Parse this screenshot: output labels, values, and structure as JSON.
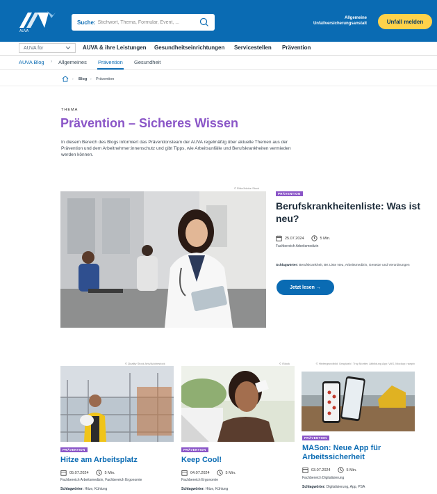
{
  "header": {
    "logo_text": "AUVA",
    "search_label": "Suche:",
    "search_placeholder": "Stichwort, Thema, Formular, Event, ...",
    "org_line1": "Allgemeine",
    "org_line2": "Unfallversicherungsanstalt",
    "unfall_button": "Unfall melden"
  },
  "nav": {
    "select_label": "AUVA für",
    "items": [
      "AUVA & ihre Leistungen",
      "Gesundheitseinrichtungen",
      "Servicestellen",
      "Prävention"
    ]
  },
  "subnav": {
    "items": [
      "AUVA Blog",
      "Allgemeines",
      "Prävention",
      "Gesundheit"
    ],
    "active": "Prävention"
  },
  "breadcrumb": {
    "items": [
      "Blog",
      "Prävention"
    ]
  },
  "intro": {
    "eyebrow": "THEMA",
    "title": "Prävention – Sicheres Wissen",
    "text": "In diesem Bereich des Blogs informiert das Präventionsteam der AUVA regelmäßig über aktuelle Themen aus der Prävention und dem Arbeitnehmer:innenschutz und gibt Tipps, wie Arbeitsunfälle und Berufskrankheiten vermieden werden können."
  },
  "featured": {
    "credit": "© Rido/Adobe Stock",
    "tag": "PRÄVENTION",
    "title": "Berufskrankheitenliste: Was ist neu?",
    "date": "25.07.2024",
    "duration": "5 Min.",
    "department": "Fachbereich Arbeitsmedizin",
    "keywords_label": "Schlagwörter:",
    "keywords": "Berufskrankheit, BK Liste Neu, Arbeitsmedizin, Gesetze und Verordnungen",
    "button": "Jetzt lesen  →"
  },
  "cards": [
    {
      "credit": "© Quality Stock Arts/Adobestock",
      "tag": "PRÄVENTION",
      "title": "Hitze am Arbeitsplatz",
      "date": "05.07.2024",
      "duration": "5 Min.",
      "department": "Fachbereich Arbeitsmedizin, Fachbereich Ergonomie",
      "keywords_label": "Schlagwörter:",
      "keywords": "Hitze, Kühlung"
    },
    {
      "credit": "© iStock",
      "tag": "PRÄVENTION",
      "title": "Keep Cool!",
      "date": "04.07.2024",
      "duration": "5 Min.",
      "department": "Fachbereich Ergonomie",
      "keywords_label": "Schlagwörter:",
      "keywords": "Hitze, Kühlung"
    },
    {
      "credit": "© Hintergrundbild: Unsplash / Troy Mortier, Abbildung App: VAS, Mockup: rawpix",
      "tag": "PRÄVENTION",
      "title": "MASon: Neue App für Arbeitssicherheit",
      "date": "03.07.2024",
      "duration": "5 Min.",
      "department": "Fachbereich Digitalisierung",
      "keywords_label": "Schlagwörter:",
      "keywords": "Digitalisierung, App, PSA"
    }
  ],
  "colors": {
    "brand_blue": "#0a6bb3",
    "accent_purple": "#8a55c7",
    "button_yellow": "#ffd24a"
  }
}
